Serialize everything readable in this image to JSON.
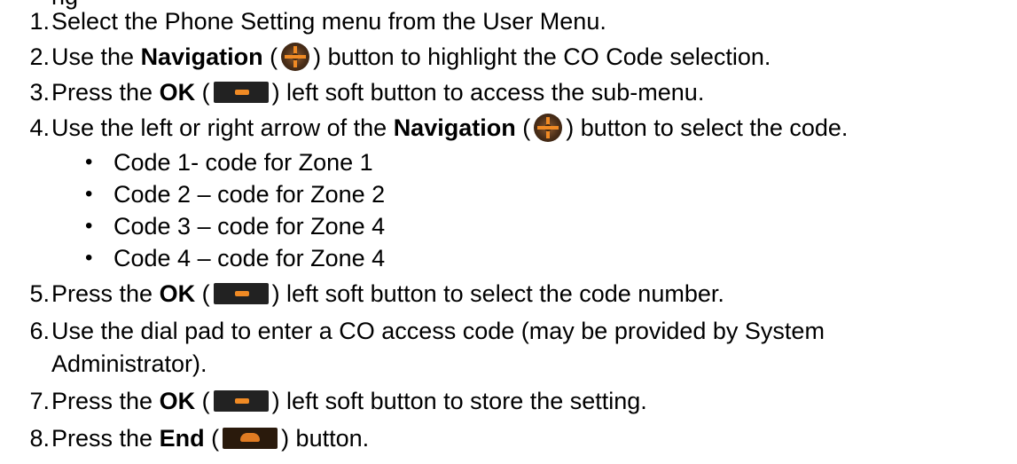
{
  "top_fragment": "ng",
  "steps": [
    {
      "num": "1.",
      "pre": "Select the Phone Setting menu from the User Menu."
    },
    {
      "num": "2.",
      "pre": "Use the ",
      "bold": "Navigation",
      "open": " (",
      "icon": "navigation-icon",
      "post": ") button to highlight the CO Code selection."
    },
    {
      "num": "3.",
      "pre": "Press the ",
      "bold": "OK",
      "open": " (",
      "icon": "ok-soft-button-icon",
      "post": ") left soft button to access the sub-menu."
    },
    {
      "num": "4.",
      "pre": "Use the left or right arrow of the ",
      "bold": "Navigation",
      "open": " (",
      "icon": "navigation-icon",
      "post": ") button to select the code."
    },
    {
      "num": "5.",
      "pre": "Press the ",
      "bold": "OK",
      "open": " (",
      "icon": "ok-soft-button-icon",
      "post": ") left soft button to select the code number."
    },
    {
      "num": "6.",
      "pre": "Use the dial pad to enter a CO access code (may be provided by System",
      "cont": "Administrator)."
    },
    {
      "num": "7.",
      "pre": "Press the ",
      "bold": "OK",
      "open": " (",
      "icon": "ok-soft-button-icon",
      "post": ") left soft button to store the setting."
    },
    {
      "num": "8.",
      "pre": "Press the ",
      "bold": "End",
      "open": " (",
      "icon": "end-button-icon",
      "post": ") button."
    }
  ],
  "codes": [
    "Code 1- code for Zone 1",
    "Code 2 – code for Zone 2",
    "Code 3 – code for Zone 4",
    "Code 4 – code for Zone 4"
  ],
  "bullet_glyph": "•"
}
